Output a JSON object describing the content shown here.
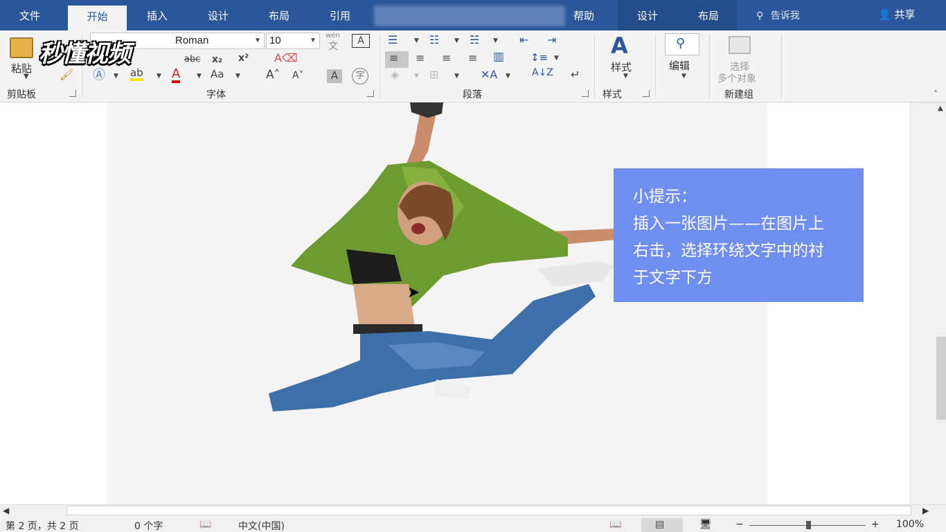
{
  "tabs": [
    {
      "label": "文件"
    },
    {
      "label": "开始"
    },
    {
      "label": "插入"
    },
    {
      "label": "设计"
    },
    {
      "label": "布局"
    },
    {
      "label": "引用"
    },
    {
      "label": "帮助"
    },
    {
      "label": "设计"
    },
    {
      "label": "布局"
    }
  ],
  "tell_me": "告诉我",
  "share": "共享",
  "watermark_logo": "秒懂视频",
  "ribbon": {
    "clipboard": {
      "paste": "粘贴",
      "label": "剪贴板"
    },
    "font": {
      "name": "Times New Roman",
      "name_visible": "Roman",
      "size": "10",
      "label": "字体",
      "wen": "wén",
      "wen_char": "文"
    },
    "paragraph": {
      "label": "段落"
    },
    "styles": {
      "button": "样式",
      "label": "样式"
    },
    "editing": {
      "button": "编辑"
    },
    "new_group": {
      "button_line1": "选择",
      "button_line2": "多个对象",
      "label": "新建组"
    }
  },
  "tip": {
    "line1": "小提示：",
    "line2": "插入一张图片——在图片上",
    "line3": "右击，选择环绕文字中的衬",
    "line4": "于文字下方"
  },
  "status": {
    "page": "第 2 页，共 2 页",
    "words": "0 个字",
    "language": "中文(中国)",
    "zoom": "100%",
    "zoom_fraction": 0.5
  }
}
